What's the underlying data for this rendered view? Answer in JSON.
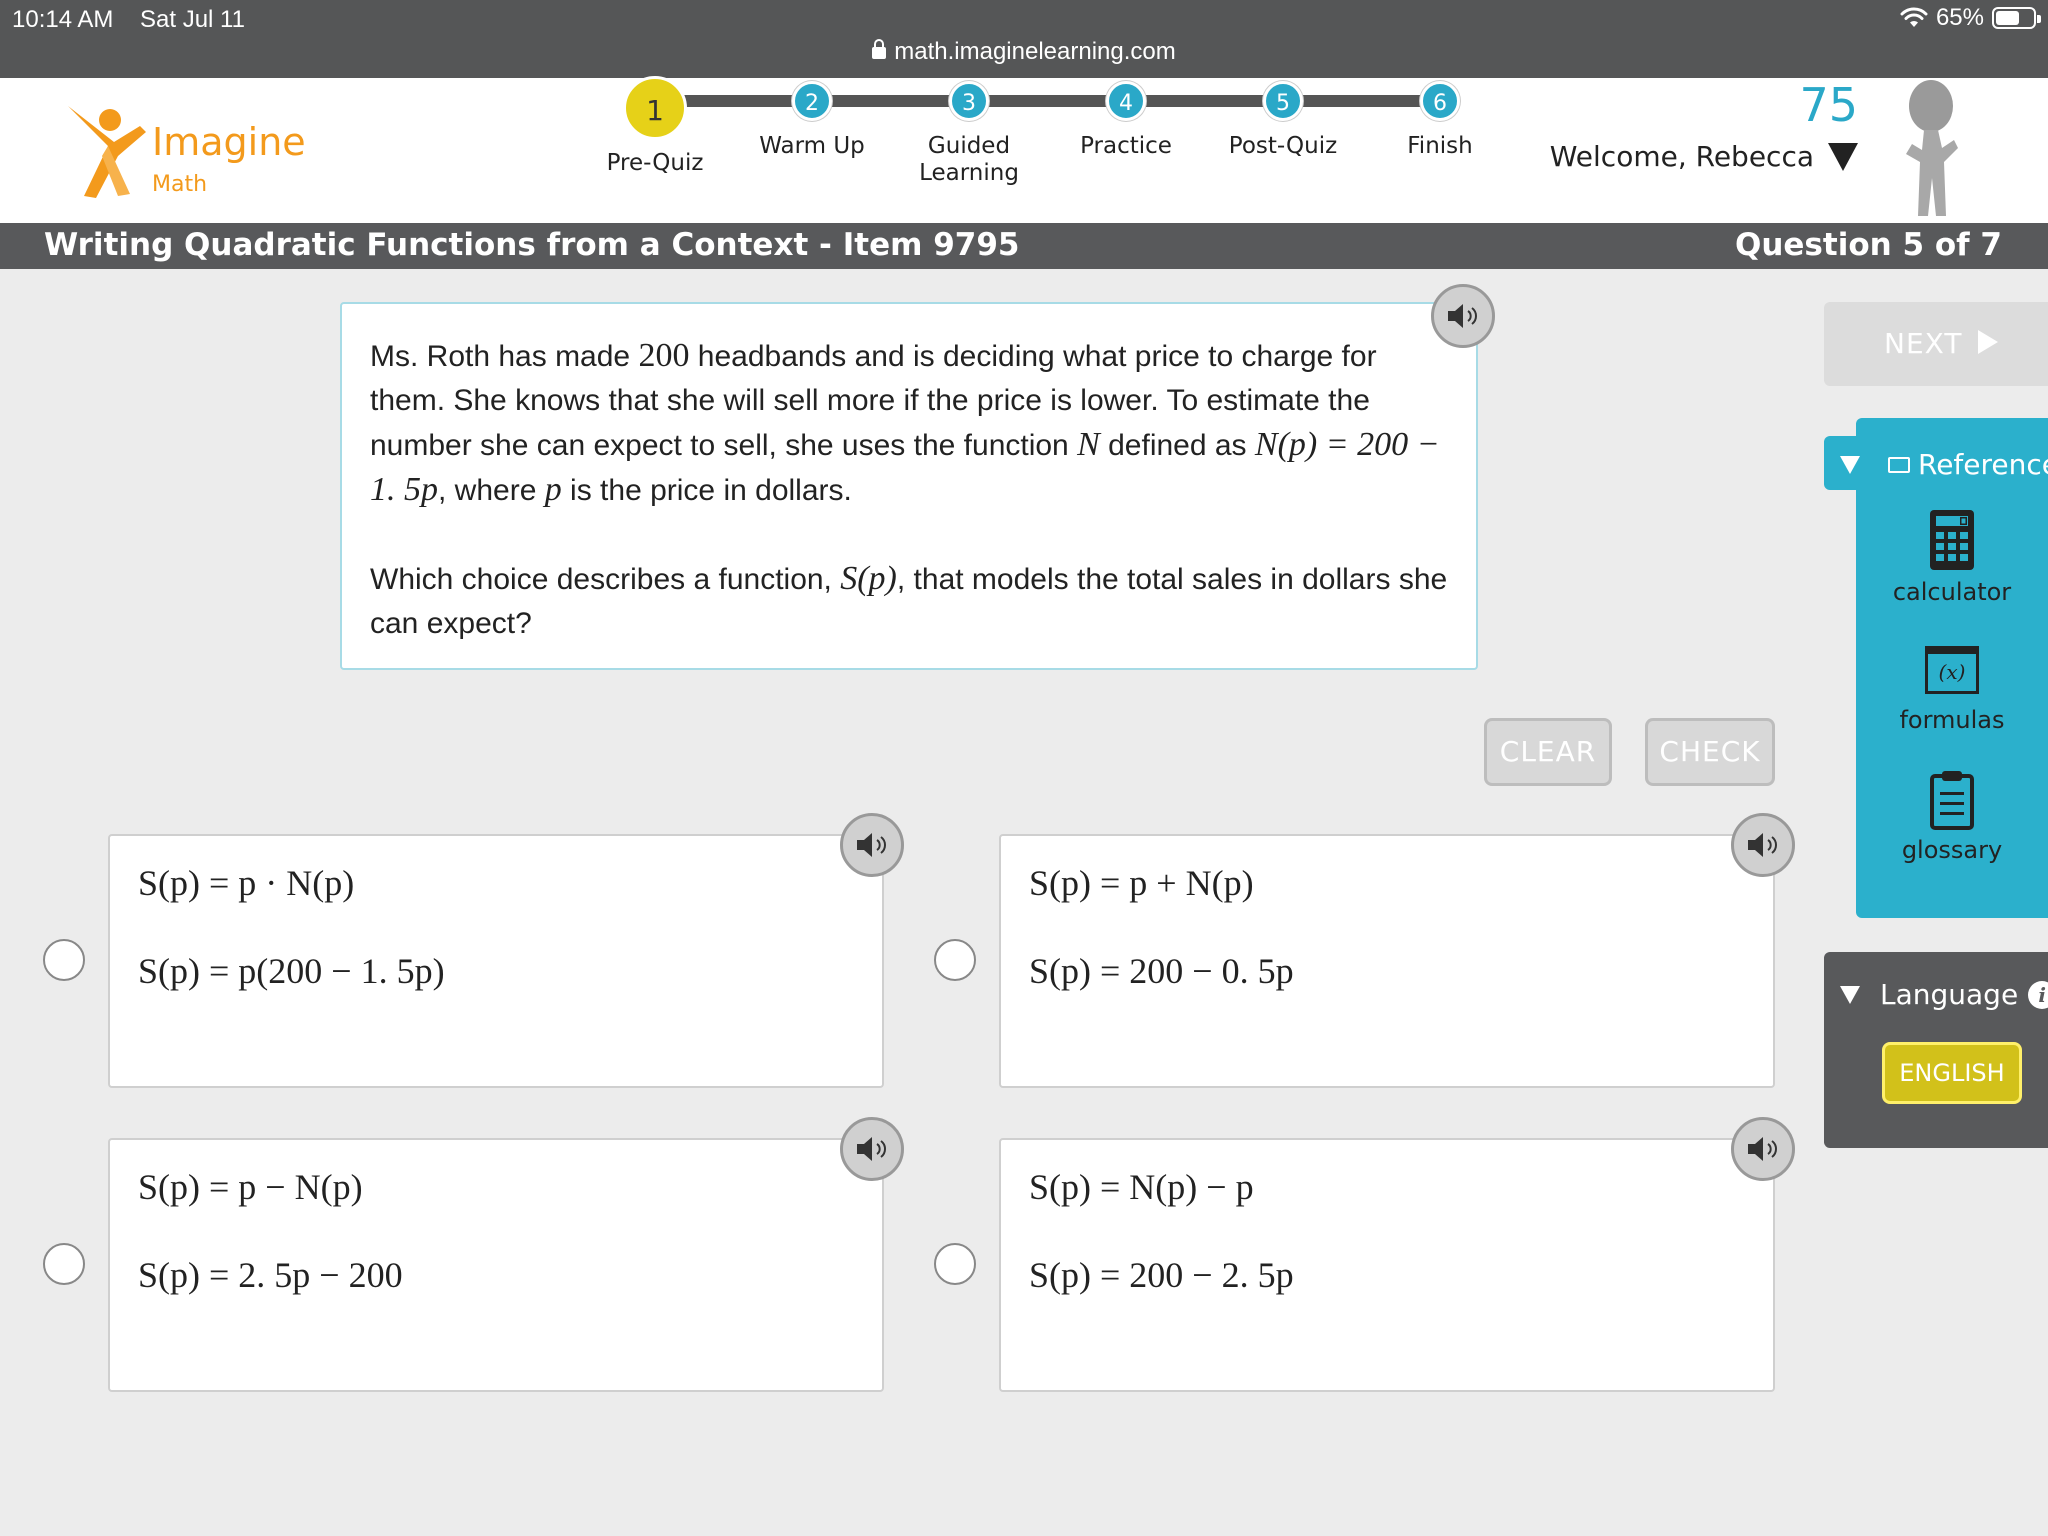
{
  "status_bar": {
    "time": "10:14 AM",
    "date": "Sat Jul 11",
    "battery": "65%",
    "battery_level": 0.65,
    "url": "math.imaginelearning.com"
  },
  "logo": {
    "name": "Imagine",
    "sub": "Math"
  },
  "steps": [
    {
      "num": "1",
      "label": "Pre-Quiz"
    },
    {
      "num": "2",
      "label": "Warm Up"
    },
    {
      "num": "3",
      "label": "Guided Learning"
    },
    {
      "num": "4",
      "label": "Practice"
    },
    {
      "num": "5",
      "label": "Post-Quiz"
    },
    {
      "num": "6",
      "label": "Finish"
    }
  ],
  "user": {
    "points": "75",
    "welcome": "Welcome, Rebecca"
  },
  "titlebar": {
    "lesson": "Writing Quadratic Functions from a Context - Item 9795",
    "question_count": "Question 5 of 7"
  },
  "question": {
    "p1_a": "Ms. Roth has made ",
    "p1_num": "200",
    "p1_b": " headbands and is deciding what price to charge for them. She knows that she will sell more if the price is lower. To estimate the number she can expect to sell, she uses the function ",
    "p1_N": "N",
    "p1_c": " defined as ",
    "p1_eq": "N(p) = 200 − 1. 5p",
    "p1_d": ", where ",
    "p1_p": "p",
    "p1_e": " is the price in dollars.",
    "p2_a": "Which choice describes a function, ",
    "p2_S": "S(p)",
    "p2_b": ", that models the total sales in dollars she can expect?"
  },
  "buttons": {
    "clear": "CLEAR",
    "check": "CHECK",
    "next": "NEXT"
  },
  "choices": [
    {
      "line1": "S(p) = p · N(p)",
      "line2": "S(p) = p(200 − 1. 5p)"
    },
    {
      "line1": "S(p) = p + N(p)",
      "line2": "S(p) = 200 − 0. 5p"
    },
    {
      "line1": "S(p) = p − N(p)",
      "line2": "S(p) = 2. 5p − 200"
    },
    {
      "line1": "S(p) = N(p) − p",
      "line2": "S(p) = 200 − 2. 5p"
    }
  ],
  "reference": {
    "header": "Reference",
    "items": {
      "calculator": "calculator",
      "formulas": "formulas",
      "formulas_glyph": "(x)",
      "glossary": "glossary"
    }
  },
  "language": {
    "header": "Language",
    "value": "ENGLISH"
  },
  "colors": {
    "accent": "#2bb0cc",
    "current_step": "#e6d118",
    "logo": "#f39a1c",
    "bar": "#58595b"
  }
}
